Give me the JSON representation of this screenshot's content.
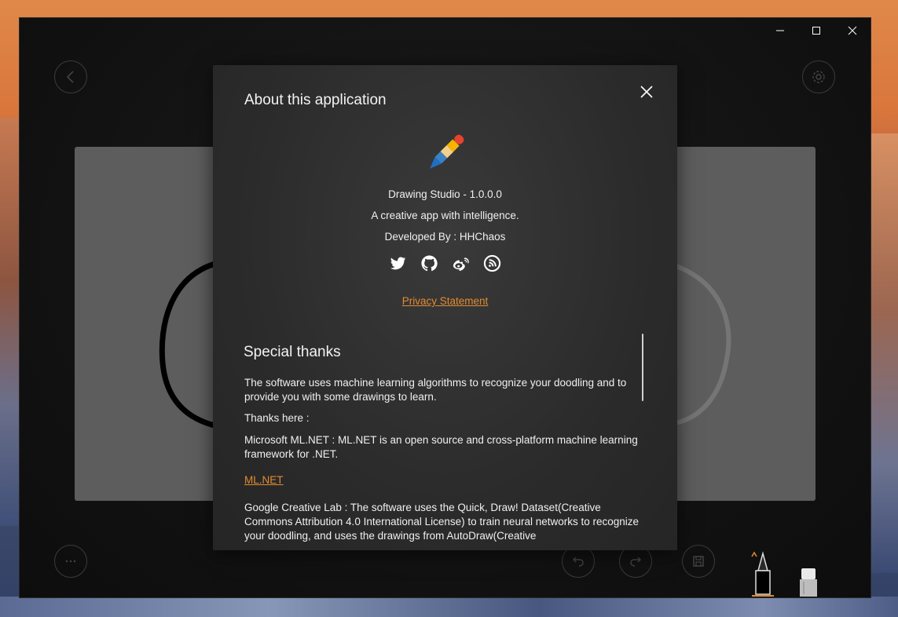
{
  "window": {
    "minimize_icon": "minimize-icon",
    "maximize_icon": "maximize-icon",
    "close_icon": "close-icon"
  },
  "dialog": {
    "title": "About this application",
    "app_name_version": "Drawing Studio - 1.0.0.0",
    "tagline": "A creative app with intelligence.",
    "developer": "Developed By : HHChaos",
    "social_icons": [
      "twitter-icon",
      "github-icon",
      "weibo-icon",
      "blog-icon"
    ],
    "privacy_link": "Privacy Statement",
    "special_thanks_title": "Special thanks",
    "thanks_intro": "The software uses machine learning algorithms to recognize your doodling and to provide you with some drawings to learn.",
    "thanks_here": "Thanks here :",
    "mlnet_text": "Microsoft ML.NET : ML.NET is an open source and cross-platform machine learning framework for .NET.",
    "mlnet_link": "ML.NET",
    "google_text": "Google Creative Lab : The software uses the Quick, Draw! Dataset(Creative Commons Attribution 4.0 International License) to train neural networks to recognize your doodling, and uses the drawings from AutoDraw(Creative"
  },
  "colors": {
    "accent": "#e38b2f",
    "dialog_bg": "#2e2e2e",
    "canvas": "#5d5d5d"
  }
}
